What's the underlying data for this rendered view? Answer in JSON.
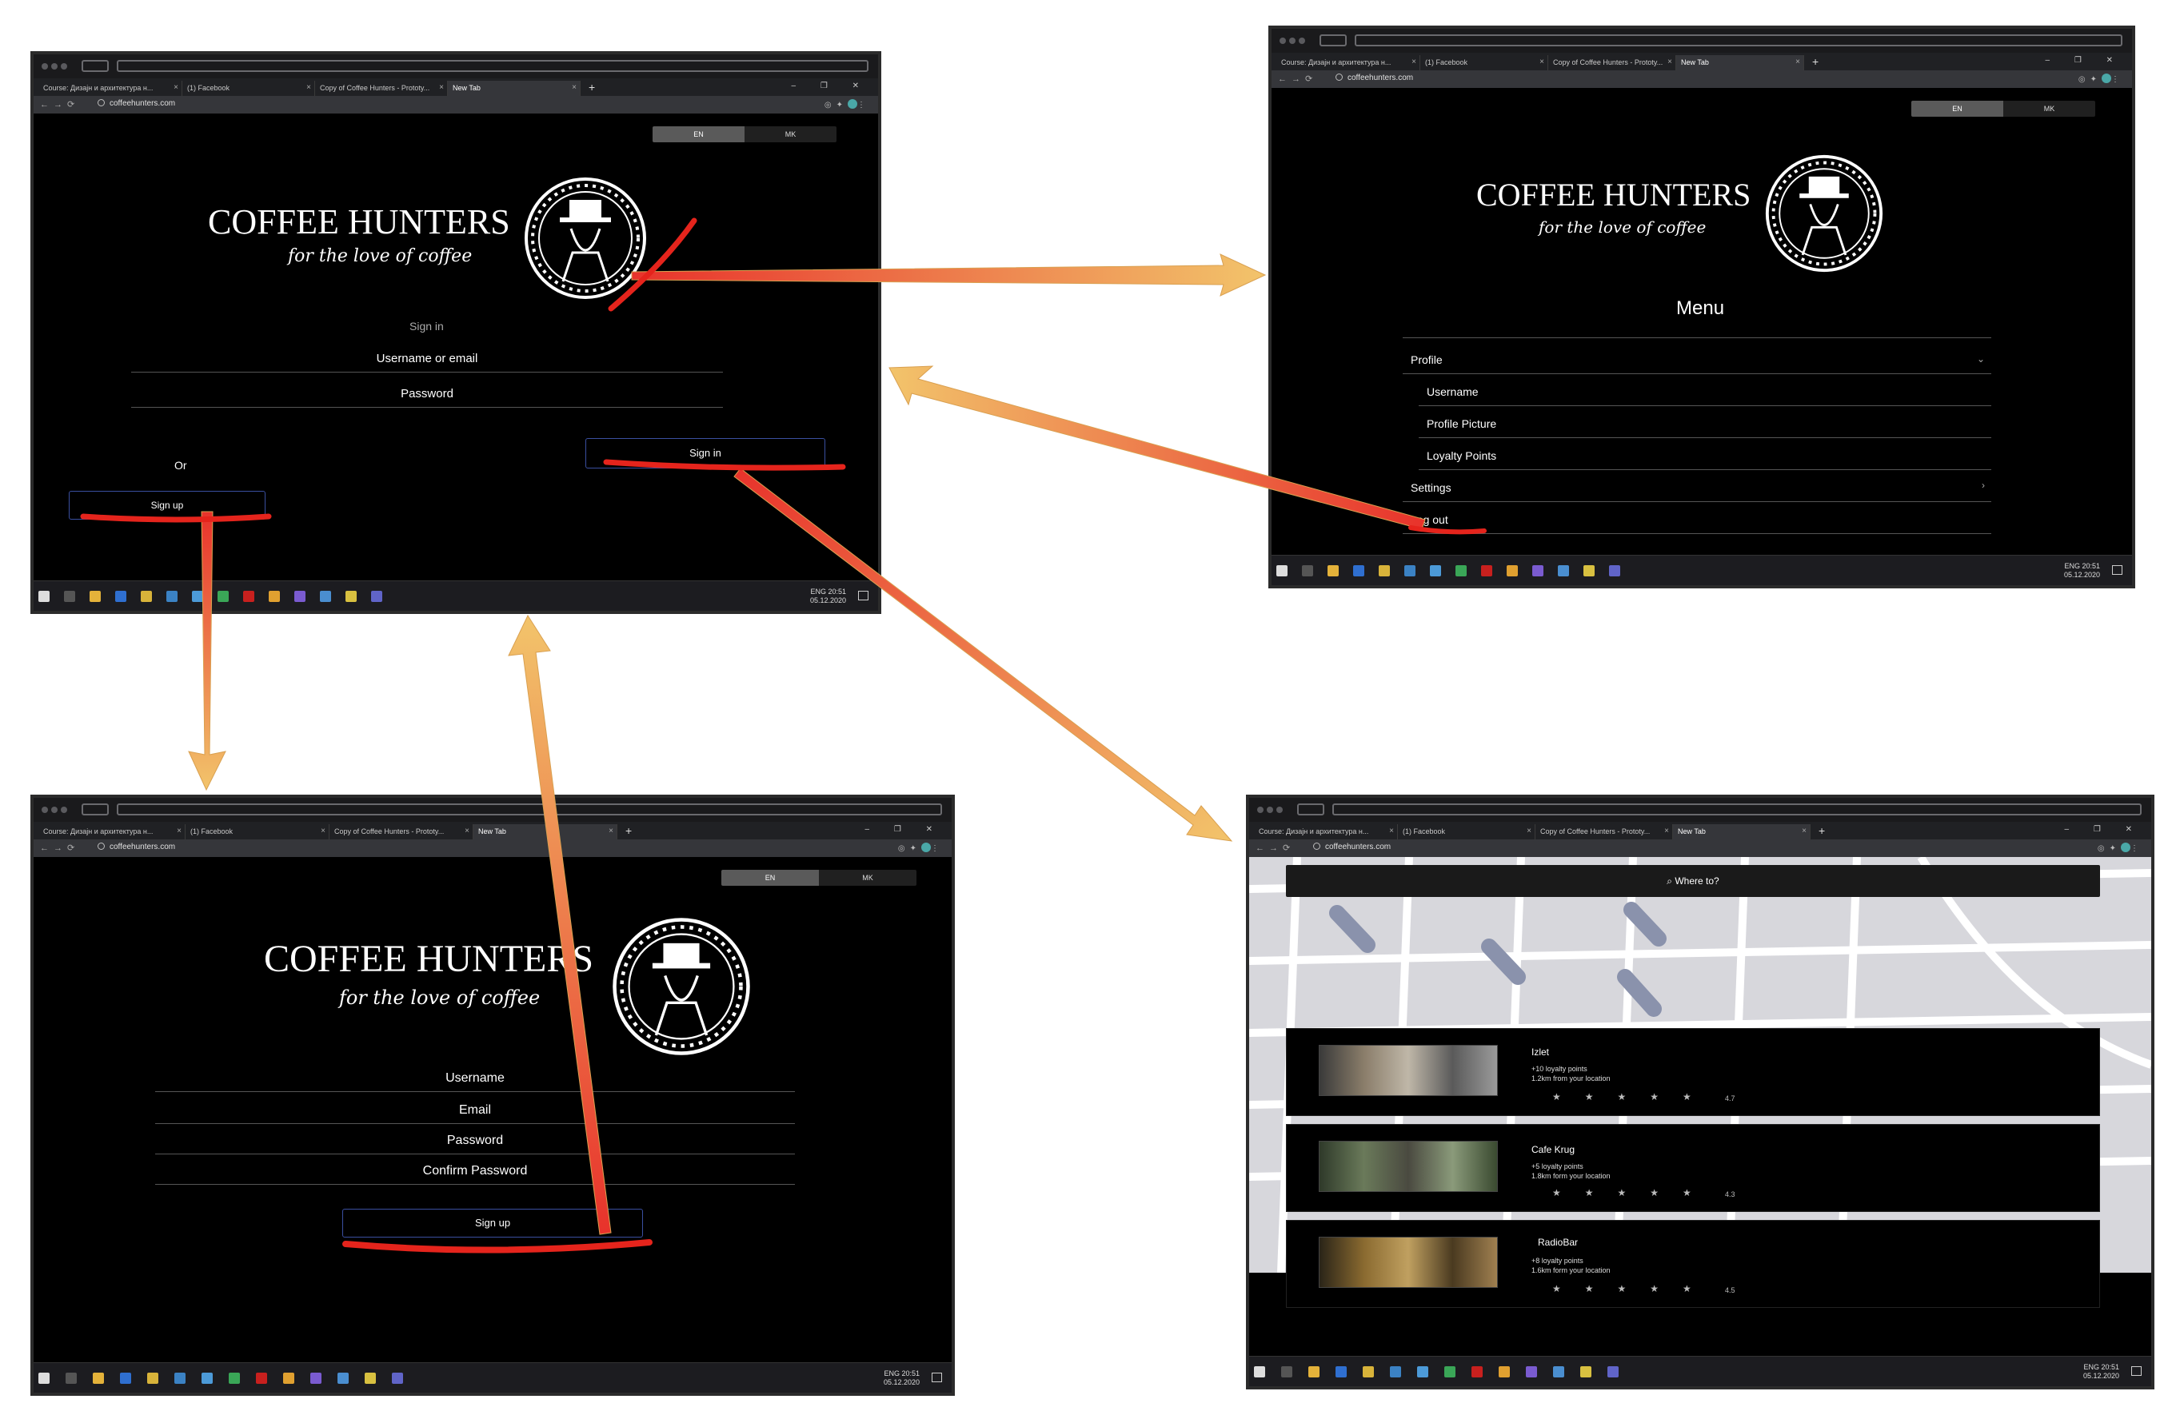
{
  "browser": {
    "tabs": [
      "Course: Дизајн и архитектура н...",
      "(1) Facebook",
      "Copy of Coffee Hunters - Prototy...",
      "New Tab"
    ],
    "tab_close": "×",
    "new_tab": "+",
    "url": "coffeehunters.com",
    "window_controls": "–  ❐  ✕"
  },
  "taskbar": {
    "time": "20:51",
    "date": "05.12.2020",
    "lang": "ENG"
  },
  "app": {
    "brand": "COFFEE HUNTERS",
    "tagline": "for the love of coffee",
    "lang_en": "EN",
    "lang_mk": "MK"
  },
  "signin": {
    "heading": "Sign in",
    "username_label": "Username or email",
    "password_label": "Password",
    "signin_button": "Sign in",
    "or_label": "Or",
    "signup_button": "Sign up"
  },
  "menu": {
    "title": "Menu",
    "items": [
      {
        "label": "Profile",
        "indent": false,
        "chevron": "⌄"
      },
      {
        "label": "Username",
        "indent": true,
        "chevron": ""
      },
      {
        "label": "Profile Picture",
        "indent": true,
        "chevron": ""
      },
      {
        "label": "Loyalty Points",
        "indent": true,
        "chevron": ""
      },
      {
        "label": "Settings",
        "indent": false,
        "chevron": "›"
      },
      {
        "label": "Log out",
        "indent": false,
        "chevron": ""
      }
    ]
  },
  "signup": {
    "fields": [
      "Username",
      "Email",
      "Password",
      "Confirm Password"
    ],
    "signup_button": "Sign up"
  },
  "map_screen": {
    "search_placeholder": "Where to?",
    "search_icon": "search-icon",
    "cafes": [
      {
        "name": "Izlet",
        "points": "+10 loyalty points",
        "distance": "1.2km from your location",
        "rating": "4.7"
      },
      {
        "name": "Cafe Krug",
        "points": "+5 loyalty points",
        "distance": "1.8km form your location",
        "rating": "4.3"
      },
      {
        "name": "RadioBar",
        "points": "+8 loyalty points",
        "distance": "1.6km form your location",
        "rating": "4.5"
      }
    ],
    "stars": "★★★★★"
  },
  "colors": {
    "accent_arrow": "#e8322b",
    "arrow_light": "#f2c46b",
    "button_border": "#3a4fa0"
  }
}
